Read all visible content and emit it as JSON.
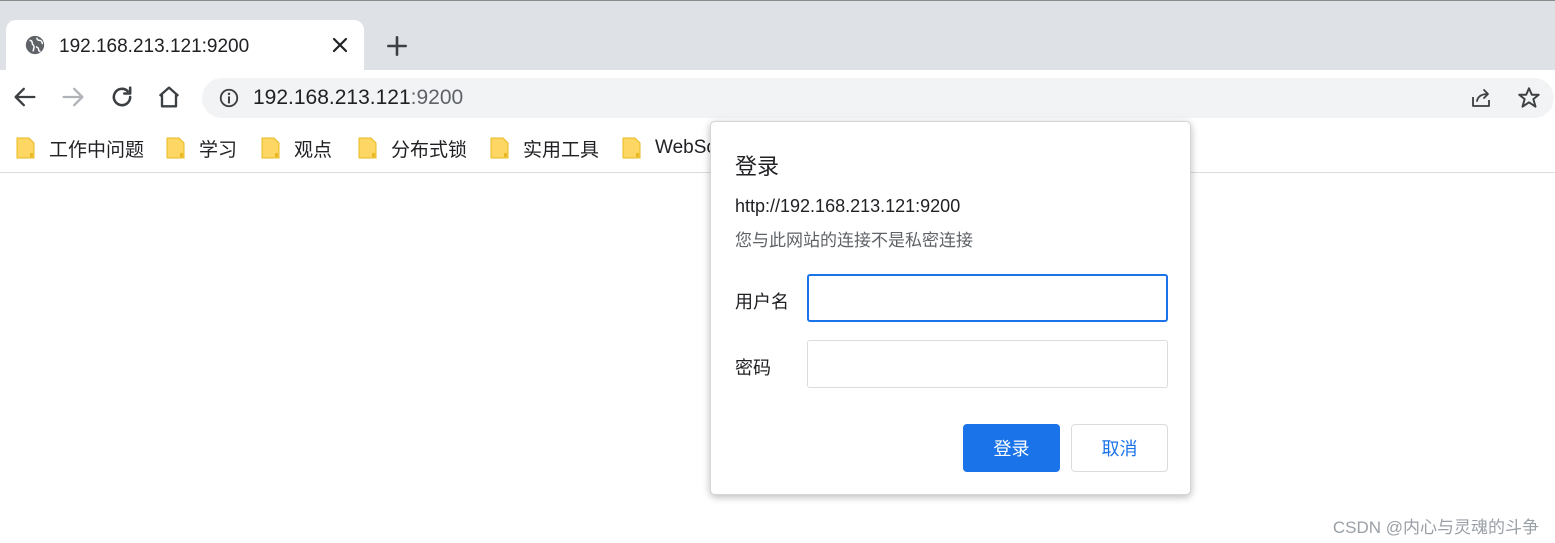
{
  "tab": {
    "title": "192.168.213.121:9200",
    "favicon_icon": "globe-icon",
    "close_icon": "close-icon"
  },
  "new_tab_icon": "plus-icon",
  "toolbar": {
    "back_icon": "arrow-left-icon",
    "forward_icon": "arrow-right-icon",
    "reload_icon": "reload-icon",
    "home_icon": "home-icon",
    "omnibox": {
      "info_icon": "info-icon",
      "url_host": "192.168.213.121",
      "url_port": ":9200",
      "share_icon": "share-icon",
      "bookmark_icon": "star-icon"
    }
  },
  "bookmarks": [
    {
      "label": "工作中问题"
    },
    {
      "label": "学习"
    },
    {
      "label": "观点"
    },
    {
      "label": "分布式锁"
    },
    {
      "label": "实用工具"
    },
    {
      "label": "WebSc"
    }
  ],
  "auth_dialog": {
    "title": "登录",
    "origin": "http://192.168.213.121:9200",
    "warning": "您与此网站的连接不是私密连接",
    "username_label": "用户名",
    "username_value": "",
    "password_label": "密码",
    "password_value": "",
    "submit_label": "登录",
    "cancel_label": "取消"
  },
  "colors": {
    "accent": "#1a73e8",
    "tabstrip": "#dee1e6",
    "omnibox": "#f1f3f4",
    "folder": "#fdd663"
  },
  "watermark": "CSDN @内心与灵魂的斗争"
}
